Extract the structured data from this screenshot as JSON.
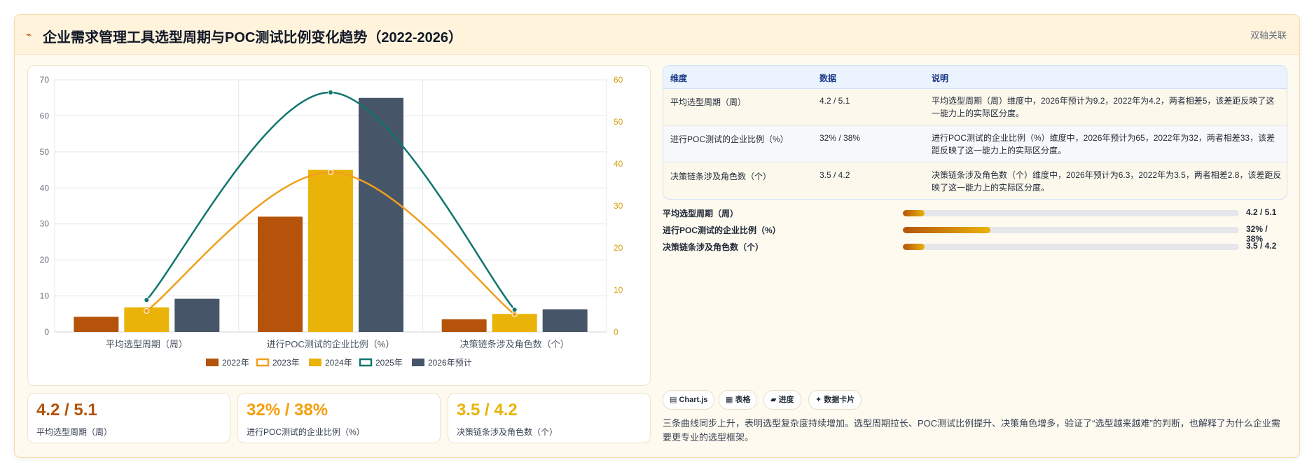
{
  "header": {
    "icon": "chart-icon",
    "title": "企业需求管理工具选型周期与POC测试比例变化趋势（2022-2026）",
    "badge": "双轴关联"
  },
  "chart_data": {
    "type": "bar",
    "categories": [
      "平均选型周期（周）",
      "进行POC测试的企业比例（%）",
      "决策链条涉及角色数（个）"
    ],
    "series": [
      {
        "name": "2022年",
        "type": "bar",
        "axis": "left",
        "color": "#b45309",
        "values": [
          4.2,
          32,
          3.5
        ]
      },
      {
        "name": "2023年",
        "type": "line",
        "axis": "right",
        "color": "#f0a01e",
        "values": [
          5.0,
          38,
          4.2
        ]
      },
      {
        "name": "2024年",
        "type": "bar",
        "axis": "left",
        "color": "#eab308",
        "values": [
          6.8,
          45,
          5.0
        ]
      },
      {
        "name": "2025年",
        "type": "line",
        "axis": "right",
        "color": "#0f766e",
        "values": [
          7.6,
          57,
          5.3
        ]
      },
      {
        "name": "2026年预计",
        "type": "bar",
        "axis": "left",
        "color": "#475569",
        "values": [
          9.2,
          65,
          6.3
        ]
      }
    ],
    "y_left": {
      "min": 0,
      "max": 70,
      "ticks": [
        "0",
        "10",
        "20",
        "30",
        "40",
        "50",
        "60",
        "70"
      ]
    },
    "y_right": {
      "min": 0,
      "max": 60,
      "ticks": [
        "0",
        "10",
        "20",
        "30",
        "40",
        "50",
        "60"
      ]
    },
    "grid": true,
    "legend_position": "bottom"
  },
  "kpis": [
    {
      "value": "4.2 / 5.1",
      "label": "平均选型周期（周）",
      "color": "#b45309"
    },
    {
      "value": "32% / 38%",
      "label": "进行POC测试的企业比例（%）",
      "color": "#f59e0b"
    },
    {
      "value": "3.5 / 4.2",
      "label": "决策链条涉及角色数（个）",
      "color": "#eab308"
    }
  ],
  "table": {
    "headers": [
      "维度",
      "数据",
      "说明"
    ],
    "rows": [
      {
        "dim": "平均选型周期（周）",
        "data": "4.2 / 5.1",
        "desc": "平均选型周期（周）维度中，2026年预计为9.2，2022年为4.2，两者相差5，该差距反映了这一能力上的实际区分度。"
      },
      {
        "dim": "进行POC测试的企业比例（%）",
        "data": "32% / 38%",
        "desc": "进行POC测试的企业比例（%）维度中，2026年预计为65，2022年为32，两者相差33，该差距反映了这一能力上的实际区分度。"
      },
      {
        "dim": "决策链条涉及角色数（个）",
        "data": "3.5 / 4.2",
        "desc": "决策链条涉及角色数（个）维度中，2026年预计为6.3，2022年为3.5，两者相差2.8，该差距反映了这一能力上的实际区分度。"
      }
    ]
  },
  "progress": [
    {
      "label": "平均选型周期（周）",
      "value": "4.2 / 5.1",
      "fraction": 0.065
    },
    {
      "label": "进行POC测试的企业比例（%）",
      "value": "32% / 38%",
      "fraction": 0.26
    },
    {
      "label": "决策链条涉及角色数（个）",
      "value": "3.5 / 4.2",
      "fraction": 0.065
    }
  ],
  "tags": [
    "▤ Chart.js",
    "▦ 表格",
    "▰ 进度",
    "✦ 数据卡片"
  ],
  "summary": "三条曲线同步上升，表明选型复杂度持续增加。选型周期拉长、POC测试比例提升、决策角色增多，验证了“选型越来越难”的判断，也解释了为什么企业需要更专业的选型框架。"
}
